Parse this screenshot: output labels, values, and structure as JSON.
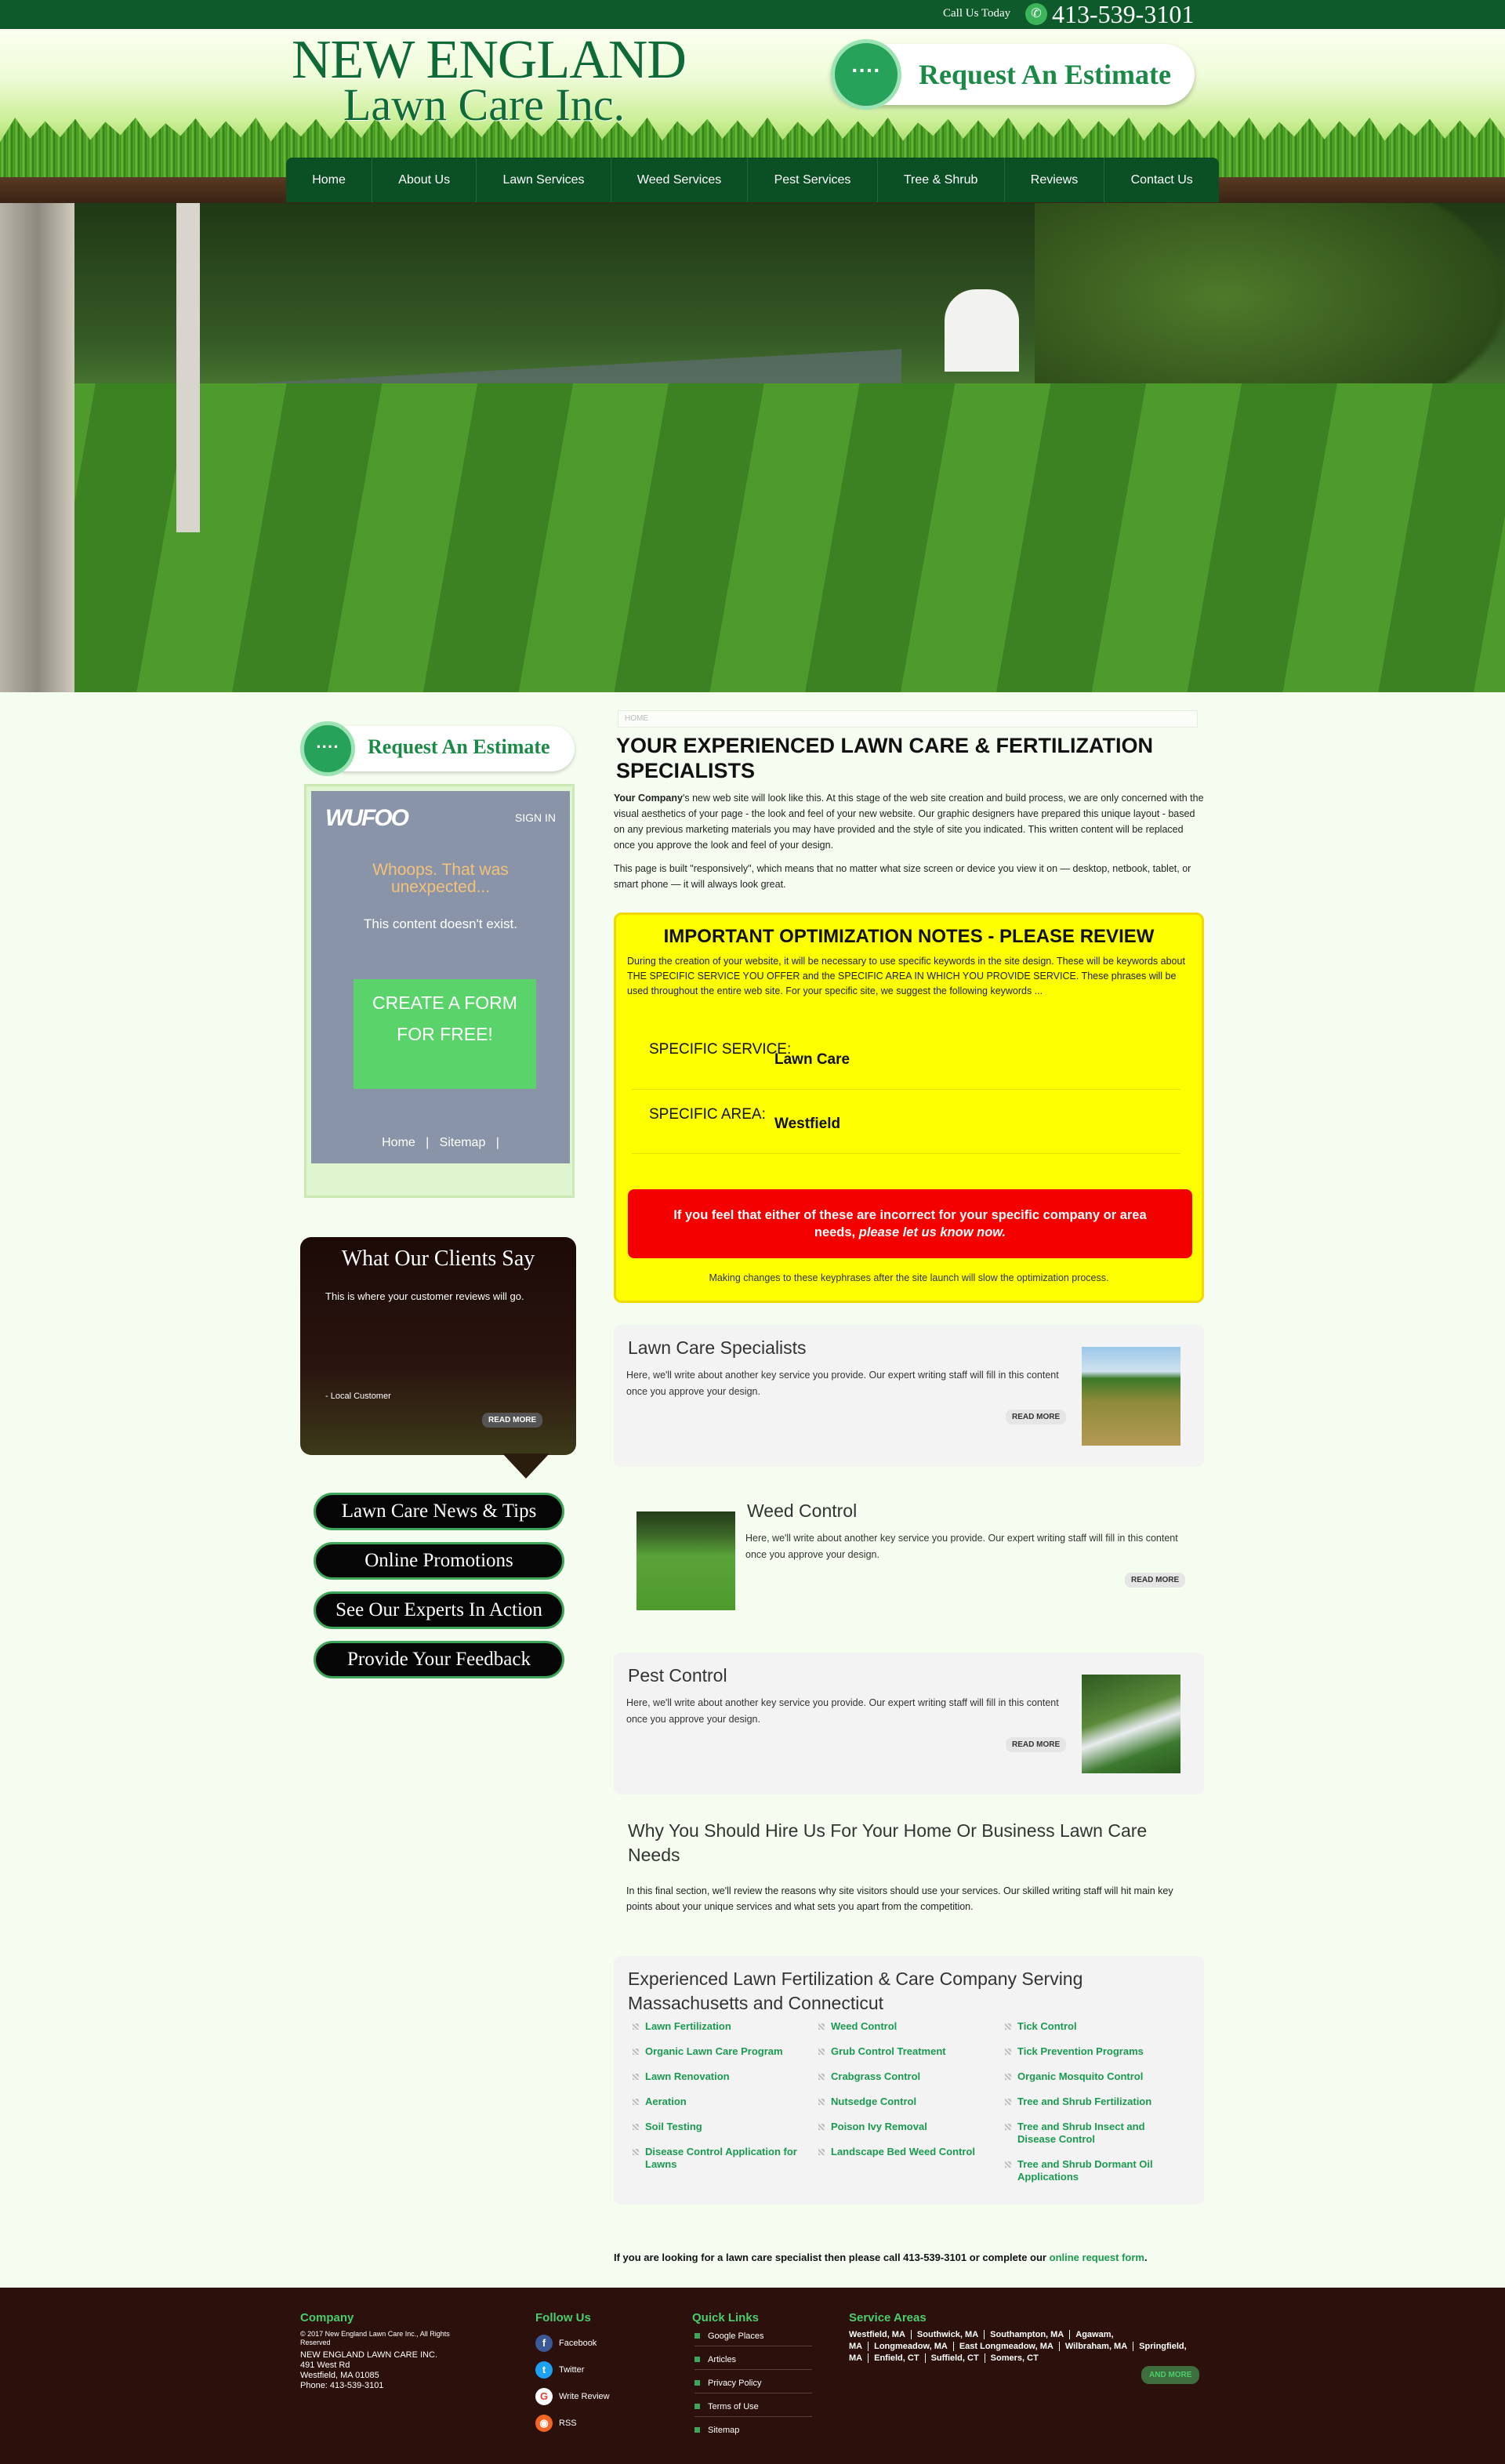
{
  "topbar": {
    "call_label": "Call Us Today",
    "phone": "413-539-3101"
  },
  "header": {
    "logo_line1": "NEW ENGLAND",
    "logo_line2": "Lawn Care Inc.",
    "estimate_label": "Request An Estimate"
  },
  "nav": {
    "items": [
      "Home",
      "About Us",
      "Lawn Services",
      "Weed Services",
      "Pest Services",
      "Tree & Shrub",
      "Reviews",
      "Contact Us"
    ]
  },
  "sidebar": {
    "estimate_label": "Request An Estimate",
    "form": {
      "logo": "WUFOO",
      "signin": "SIGN IN",
      "whoops": "Whoops. That was unexpected...",
      "missing": "This content doesn't exist.",
      "create": "CREATE A FORM FOR FREE!",
      "link_home": "Home",
      "link_sitemap": "Sitemap"
    },
    "reviews": {
      "title": "What Our Clients Say",
      "body": "This is where your customer reviews will go.",
      "cite": "- Local Customer",
      "more": "READ MORE"
    },
    "buttons": [
      "Lawn Care News & Tips",
      "Online Promotions",
      "See Our Experts In Action",
      "Provide Your Feedback"
    ]
  },
  "main": {
    "breadcrumb": "HOME",
    "title": "YOUR EXPERIENCED LAWN CARE & FERTILIZATION SPECIALISTS",
    "intro_bold": "Your Company",
    "intro": "'s new web site will look like this. At this stage of the web site creation and build process, we are only concerned with the visual aesthetics of your page - the look and feel of your new website. Our graphic designers have prepared this unique layout - based on any previous marketing materials you may have provided and the style of site you indicated. This written content will be replaced once you approve the look and feel of your design.",
    "responsive": "This page is built \"responsively\", which means that no matter what size screen or device you view it on — desktop, netbook, tablet, or smart phone — it will always look great.",
    "optimization": {
      "title": "IMPORTANT OPTIMIZATION NOTES - PLEASE REVIEW",
      "desc": "During the creation of your website, it will be necessary to use specific keywords in the site design. These will be keywords about THE SPECIFIC SERVICE YOU OFFER and the SPECIFIC AREA IN WHICH YOU PROVIDE SERVICE. These phrases will be used throughout the entire web site. For your specific site, we suggest the following keywords ...",
      "service_label": "SPECIFIC SERVICE:",
      "service_value": "Lawn Care",
      "area_label": "SPECIFIC AREA:",
      "area_value": "Westfield",
      "warning": "If you feel that either of these are incorrect for your specific company or area needs,",
      "warning_link": "please let us know now.",
      "note": "Making changes to these keyphrases after the site launch will slow the optimization process."
    },
    "services": [
      {
        "title": "Lawn Care Specialists",
        "desc": "Here, we'll write about another key service you provide. Our expert writing staff will fill in this content once you approve your design.",
        "more": "READ MORE"
      },
      {
        "title": "Weed Control",
        "desc": "Here, we'll write about another key service you provide. Our expert writing staff will fill in this content once you approve your design.",
        "more": "READ MORE"
      },
      {
        "title": "Pest Control",
        "desc": "Here, we'll write about another key service you provide. Our expert writing staff will fill in this content once you approve your design.",
        "more": "READ MORE"
      }
    ],
    "why": {
      "title": "Why You Should Hire Us For Your Home Or Business Lawn Care Needs",
      "desc": "In this final section, we'll review the reasons why site visitors should use your services. Our skilled writing staff will hit main key points about your unique services and what sets you apart from the competition."
    },
    "links": {
      "title": "Experienced Lawn Fertilization & Care Company Serving Massachusetts and Connecticut",
      "col1": [
        "Lawn Fertilization",
        "Organic Lawn Care Program",
        "Lawn Renovation",
        "Aeration",
        "Soil Testing",
        "Disease Control Application for Lawns"
      ],
      "col2": [
        "Weed Control",
        "Grub Control Treatment",
        "Crabgrass Control",
        "Nutsedge Control",
        "Poison Ivy Removal",
        "Landscape Bed Weed Control"
      ],
      "col3": [
        "Tick Control",
        "Tick Prevention Programs",
        "Organic Mosquito Control",
        "Tree and Shrub Fertilization",
        "Tree and Shrub Insect and Disease Control",
        "Tree and Shrub Dormant Oil Applications"
      ]
    },
    "cta": "If you are looking for a lawn care specialist then please call 413-539-3101 or complete our",
    "cta_link": "online request form"
  },
  "footer": {
    "company_title": "Company",
    "company_lines": [
      "© 2017 New England Lawn Care Inc., All Rights Reserved",
      "NEW ENGLAND LAWN CARE INC.",
      "491 West Rd",
      "Westfield, MA 01085",
      "Phone: 413-539-3101"
    ],
    "follow_title": "Follow Us",
    "follow": [
      "Facebook",
      "Twitter",
      "Write Review",
      "RSS"
    ],
    "quick_title": "Quick Links",
    "quick": [
      "Google Places",
      "Articles",
      "Privacy Policy",
      "Terms of Use",
      "Sitemap"
    ],
    "areas_title": "Service Areas",
    "areas": [
      "Westfield, MA",
      "Southwick, MA",
      "Southampton, MA",
      "Agawam, MA",
      "Longmeadow, MA",
      "East Longmeadow, MA",
      "Wilbraham, MA",
      "Springfield, MA",
      "Enfield, CT",
      "Suffield, CT",
      "Somers, CT"
    ],
    "and_more": "AND MORE"
  }
}
